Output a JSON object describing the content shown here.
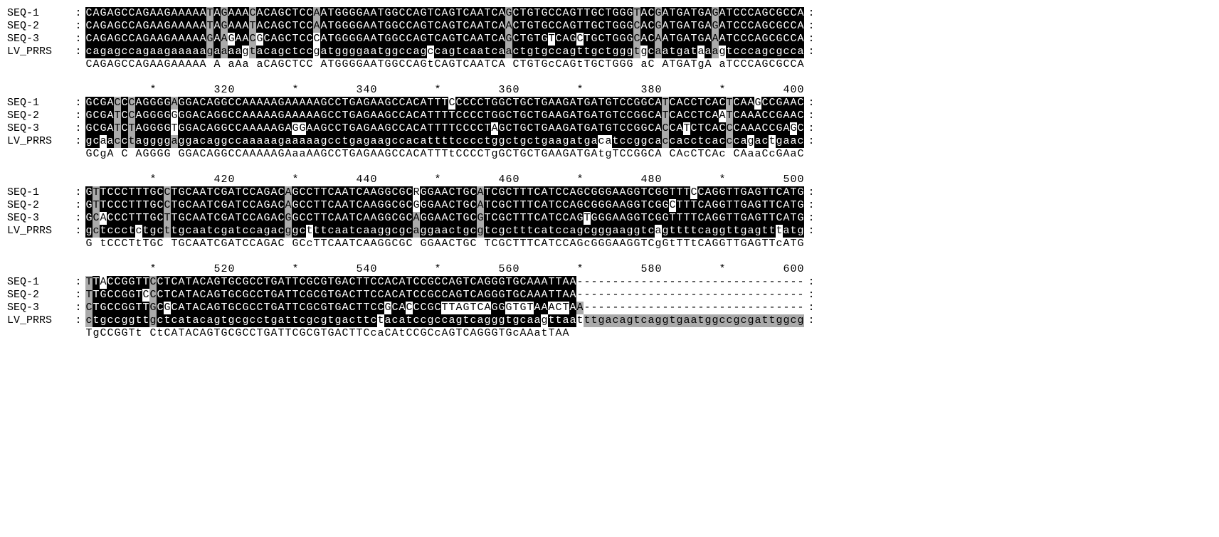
{
  "labels": [
    "SEQ-1",
    "SEQ-2",
    "SEQ-3",
    "LV_PRRS"
  ],
  "blocks": [
    {
      "ruler_marks": [],
      "seqs": [
        "CAGAGCCAGAAGAAAAATAGAAACACAGCTCCAATGGGGAATGGCCAGTCAGTCAATCAGCTGTGCCAGTTGCTGGGTACGATGATGAGATCCCAGCGCCA",
        "CAGAGCCAGAAGAAAAATAGAAATACAGCTCCAATGGGGAATGGCCAGTCAGTCAATCAACTGTGCCAGTTGCTGGGCACGATGATGAGATCCCAGCGCCA",
        "CAGAGCCAGAAGAAAAAGAAGAACGCAGCTCCCATGGGGAATGGCCAGTCAGTCAATCAGCTGTGTCAGCTGCTGGGCACAATGATGAAATCCCAGCGCCA",
        "cagagccagaagaaaaagaaaagtacagctccgatggggaatggccagccagtcaatcaactgtgccagttgctgggtgcaatgataaagtcccagcgcca"
      ],
      "consensus": "CAGAGCCAGAAGAAAAA A aAa aCAGCTCC ATGGGGAATGGCCAGtCAGTCAATCA CTGTGcCAGtTGCTGGG aC ATGATgA aTCCCAGCGCCA"
    },
    {
      "ruler_marks": [
        {
          "pos": 10,
          "label": "*"
        },
        {
          "pos": 20,
          "label": "320"
        },
        {
          "pos": 30,
          "label": "*"
        },
        {
          "pos": 40,
          "label": "340"
        },
        {
          "pos": 50,
          "label": "*"
        },
        {
          "pos": 60,
          "label": "360"
        },
        {
          "pos": 70,
          "label": "*"
        },
        {
          "pos": 80,
          "label": "380"
        },
        {
          "pos": 90,
          "label": "*"
        },
        {
          "pos": 100,
          "label": "400"
        }
      ],
      "seqs": [
        "GCGACCCAGGGGAGGACAGGCCAAAAAGAAAAAGCCTGAGAAGCCACATTTCCCCCTGGCTGCTGAAGATGATGTCCGGCATCACCTCACTCAAGCCGAAC",
        "GCGATCCAGGGGGGGACAGGCCAAAAAGAAAAAGCCTGAGAAGCCACATTTTCCCCTGGCTGCTGAAGATGATGTCCGGCATCACCTCAATCAAACCGAAC",
        "GCGATCTAGGGGTGGACAGGCCAAAAAGAGGAAGCCTGAGAAGCCACATTTTCCCCTAGCTGCTGAAGATGATGTCCGGCACCATCTCACCCAAACCGAGC",
        "gcaacctaggggaggacaggccaaaaagaaaaagcctgagaagccacattttcccctggctgctgaagatgacatccggcaccacctcacccagactgaac"
      ],
      "consensus": "GCgA C AGGGG GGACAGGCCAAAAAGAaaAAGCCTGAGAAGCCACATTTtCCCCTgGCTGCTGAAGATGAtgTCCGGCA CAcCTCAc CAaaCcGAaC"
    },
    {
      "ruler_marks": [
        {
          "pos": 10,
          "label": "*"
        },
        {
          "pos": 20,
          "label": "420"
        },
        {
          "pos": 30,
          "label": "*"
        },
        {
          "pos": 40,
          "label": "440"
        },
        {
          "pos": 50,
          "label": "*"
        },
        {
          "pos": 60,
          "label": "460"
        },
        {
          "pos": 70,
          "label": "*"
        },
        {
          "pos": 80,
          "label": "480"
        },
        {
          "pos": 90,
          "label": "*"
        },
        {
          "pos": 100,
          "label": "500"
        }
      ],
      "seqs": [
        "GTTCCCTTTGCCTGCAATCGATCCAGACAGCCTTCAATCAAGGCGCRGGAACTGCATCGCTTTCATCCAGCGGGAAGGTCGGTTTCCAGGTTGAGTTCATG",
        "GTTCCCTTTGCCTGCAATCGATCCAGACAGCCTTCAATCAAGGCGCGGGAACTGCATCGCTTTCATCCAGCGGGAAGGTCGGCTTTCAGGTTGAGTTCATG",
        "GCACCCTTTGCTTGCAATCGATCCAGACGGCCTTCAATCAAGGCGCAGGAACTGCGTCGCTTTCATCCAGTGGGAAGGTCGGTTTTCAGGTTGAGTTCATG",
        "gctccctctgcttgcaatcgatccagacggctttcaatcaaggcgcaggaactgcgtcgctttcatccagcgggaaggtcagttttcaggttgagtttatg"
      ],
      "consensus": "G tCCCTtTGC TGCAATCGATCCAGAC GCcTTCAATCAAGGCGC GGAACTGC TCGCTTTCATCCAGcGGGAAGGTCgGtTTtCAGGTTGAGTTcATG"
    },
    {
      "ruler_marks": [
        {
          "pos": 10,
          "label": "*"
        },
        {
          "pos": 20,
          "label": "520"
        },
        {
          "pos": 30,
          "label": "*"
        },
        {
          "pos": 40,
          "label": "540"
        },
        {
          "pos": 50,
          "label": "*"
        },
        {
          "pos": 60,
          "label": "560"
        },
        {
          "pos": 70,
          "label": "*"
        },
        {
          "pos": 80,
          "label": "580"
        },
        {
          "pos": 90,
          "label": "*"
        },
        {
          "pos": 100,
          "label": "600"
        }
      ],
      "seqs": [
        "TTACCGGTTCCTCATACAGTGCGCCTGATTCGCGTGACTTCCACATCCGCCAGTCAGGGTGCAAATTAA--------------------------------",
        "TTGCCGGTCCCTCATACAGTGCGCCTGATTCGCGTGACTTCCACATCCGCCAGTCAGGGTGCAAATTAA--------------------------------",
        "CTGCCGGTTGCGCATACAGTGCGCCTGATTCGCGTGACTTCCGCACCCGCTTAGTCAGGGTGTAAACTAA-------------------------------",
        "ctgccggttgctcatacagtgcgcctgattcgcgtgacttctacatccgccagtcagggtgcaagttaatttgacagtcaggtgaatggccgcgattggcg"
      ],
      "consensus": "TgCCGGTt CtCATACAGTGCGCCTGATTCGCGTGACTTCcaCAtCCGCcAGTCAGGGTGcAAatTAA"
    }
  ]
}
